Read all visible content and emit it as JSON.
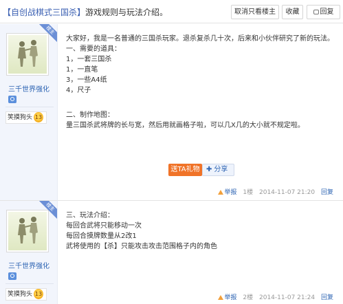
{
  "header": {
    "title_tag": "【自创战棋式三国杀】",
    "title_rest": "游戏规则与玩法介绍。",
    "btn_only_owner": "取消只看楼主",
    "btn_favorite": "收藏",
    "btn_reply": "回复"
  },
  "posts": [
    {
      "username": "三千世界强化",
      "owner_badge": "楼主",
      "rank_title": "笑摸狗头",
      "rank_level": "13",
      "lines": [
        "大家好，我是一名普通的三国杀玩家。退杀复杀几十次，后来和小伙伴研究了新的玩法。",
        "一、需要的道具：",
        "1，一套三国杀",
        "1，一直笔",
        "3，一些A4纸",
        "4，尺子",
        "",
        "二、制作地图：",
        "量三国杀武将牌的长与宽，然后用就画格子啦，可以几X几的大小就不规定啦。"
      ],
      "gift_label": "送TA礼物",
      "share_label": "分享",
      "report": "举报",
      "floor": "1楼",
      "time": "2014-11-07 21:20",
      "reply": "回复"
    },
    {
      "username": "三千世界强化",
      "owner_badge": "楼主",
      "rank_title": "笑摸狗头",
      "rank_level": "13",
      "lines": [
        "三、玩法介绍：",
        "每回合武将只能移动一次",
        "每回合摸牌数量从2改1",
        "武将使用的【杀】只能攻击攻击范围格子内的角色"
      ],
      "report": "举报",
      "floor": "2楼",
      "time": "2014-11-07 21:24",
      "reply": "回复"
    }
  ]
}
